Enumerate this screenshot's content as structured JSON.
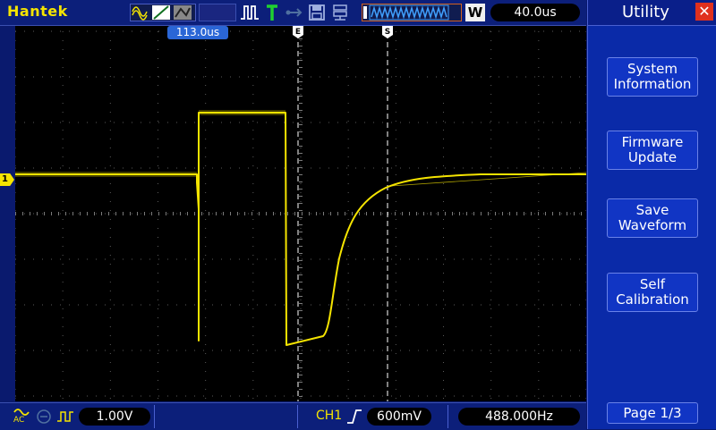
{
  "header": {
    "brand": "Hantek",
    "timebase": "40.0us",
    "mode_badge": "W"
  },
  "screen": {
    "cursor_label": "113.0us",
    "channel_marker": "1",
    "trigger_marker": "E",
    "cursor_marker": "S"
  },
  "menu": {
    "title": "Utility",
    "buttons": [
      "System\nInformation",
      "Firmware\nUpdate",
      "Save\nWaveform",
      "Self\nCalibration"
    ],
    "page": "Page 1/3"
  },
  "footer": {
    "coupling": "AC",
    "ch1_scale": "1.00V",
    "trigger_channel": "CH1",
    "trigger_level": "600mV",
    "frequency": "488.000Hz"
  },
  "colors": {
    "trace": "#f5e400",
    "background": "#000000",
    "ui": "#0a2aa8"
  }
}
